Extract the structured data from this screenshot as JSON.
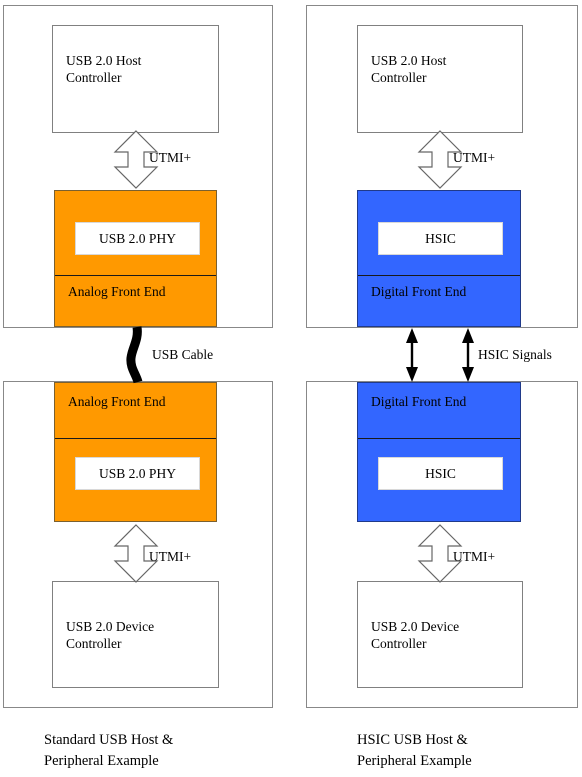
{
  "figure": {
    "title": "USB 2.0 standard PHY versus HSIC interface block diagram",
    "colors": {
      "orange": "#FF9900",
      "blue": "#3366FF",
      "frame_gray": "#888888",
      "box_gray": "#808080",
      "arrow_outline": "#666666",
      "arrow_fill": "#FFFFFF",
      "cable_black": "#000000",
      "text": "#000000"
    }
  },
  "left_column": {
    "caption": "Standard USB Host &\nPeripheral Example",
    "host_panel": {
      "controller_label": "USB 2.0 Host\nController",
      "interface_label": "UTMI+",
      "stack": {
        "chip_label": "USB 2.0 PHY",
        "front_end_label": "Analog Front End"
      }
    },
    "device_panel": {
      "controller_label": "USB 2.0 Device\nController",
      "interface_label": "UTMI+",
      "stack": {
        "chip_label": "USB 2.0 PHY",
        "front_end_label": "Analog Front End"
      }
    },
    "link_label": "USB Cable"
  },
  "right_column": {
    "caption": "HSIC USB Host &\nPeripheral Example",
    "host_panel": {
      "controller_label": "USB 2.0 Host\nController",
      "interface_label": "UTMI+",
      "stack": {
        "chip_label": "HSIC",
        "front_end_label": "Digital Front End"
      }
    },
    "device_panel": {
      "controller_label": "USB 2.0 Device\nController",
      "interface_label": "UTMI+",
      "stack": {
        "chip_label": "HSIC",
        "front_end_label": "Digital Front End"
      }
    },
    "link_label": "HSIC Signals"
  },
  "icons": {
    "utmi_arrow": "double-headed-hollow-vertical-arrow",
    "hsic_arrow": "double-headed-solid-vertical-arrow",
    "usb_cable": "wavy-cable-connector"
  }
}
